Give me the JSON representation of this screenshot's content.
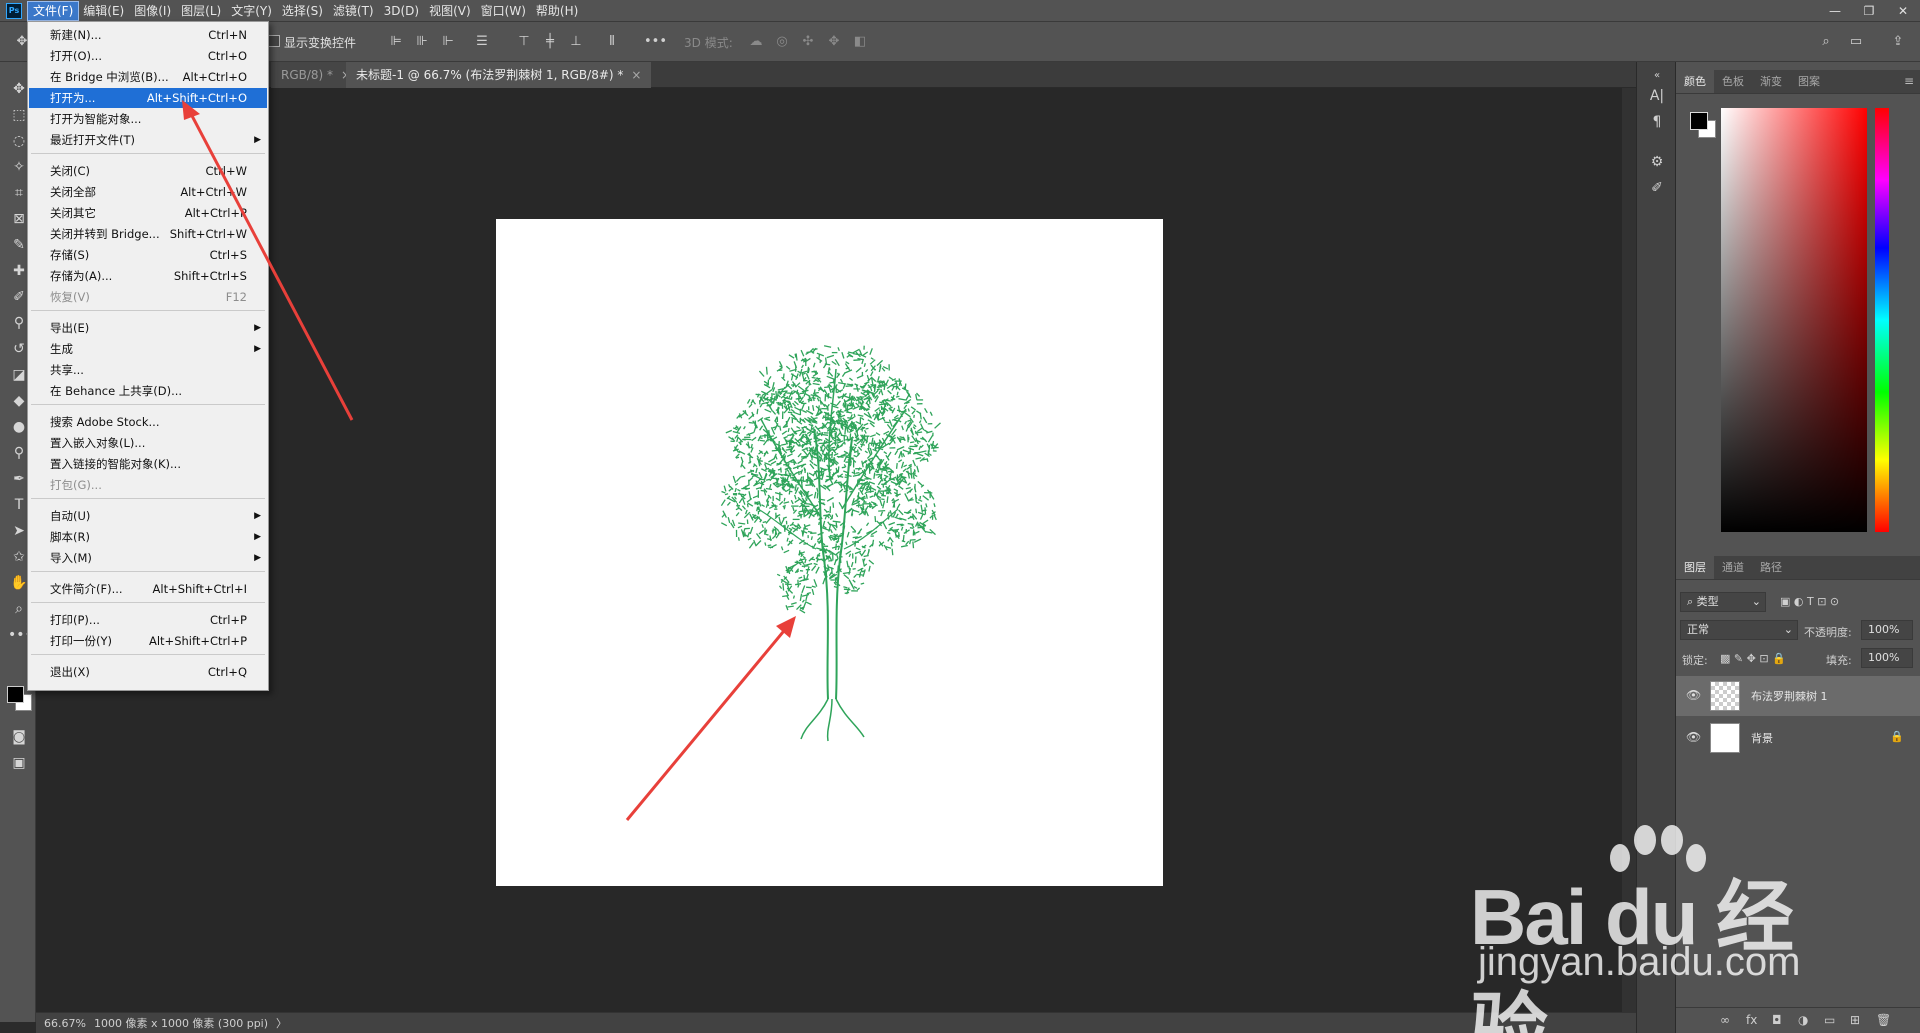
{
  "app": {
    "logo": "Ps",
    "menus": [
      "文件(F)",
      "编辑(E)",
      "图像(I)",
      "图层(L)",
      "文字(Y)",
      "选择(S)",
      "滤镜(T)",
      "3D(D)",
      "视图(V)",
      "窗口(W)",
      "帮助(H)"
    ],
    "window_controls": [
      "—",
      "❐",
      "✕"
    ]
  },
  "options_bar": {
    "show_transform_label": "显示变换控件",
    "mode_3d_label": "3D 模式:",
    "more_icon": "•••"
  },
  "tabs": [
    {
      "label": "RGB/8) *",
      "close": "×"
    },
    {
      "label": "未标题-1 @ 66.7% (布法罗荆棘树 1, RGB/8#) *",
      "close": "×"
    }
  ],
  "status_bar": {
    "zoom": "66.67%",
    "doc_info": "1000 像素 x 1000 像素 (300 ppi)",
    "arrow": "〉"
  },
  "file_menu": {
    "items": [
      {
        "label": "新建(N)...",
        "shortcut": "Ctrl+N"
      },
      {
        "label": "打开(O)...",
        "shortcut": "Ctrl+O"
      },
      {
        "label": "在 Bridge 中浏览(B)...",
        "shortcut": "Alt+Ctrl+O"
      },
      {
        "label": "打开为...",
        "shortcut": "Alt+Shift+Ctrl+O",
        "highlighted": true
      },
      {
        "label": "打开为智能对象...",
        "shortcut": ""
      },
      {
        "label": "最近打开文件(T)",
        "shortcut": "",
        "submenu": true
      },
      {
        "label": "关闭(C)",
        "shortcut": "Ctrl+W"
      },
      {
        "label": "关闭全部",
        "shortcut": "Alt+Ctrl+W"
      },
      {
        "label": "关闭其它",
        "shortcut": "Alt+Ctrl+P"
      },
      {
        "label": "关闭并转到 Bridge...",
        "shortcut": "Shift+Ctrl+W"
      },
      {
        "label": "存储(S)",
        "shortcut": "Ctrl+S"
      },
      {
        "label": "存储为(A)...",
        "shortcut": "Shift+Ctrl+S"
      },
      {
        "label": "恢复(V)",
        "shortcut": "F12",
        "disabled": true
      },
      {
        "label": "导出(E)",
        "shortcut": "",
        "submenu": true
      },
      {
        "label": "生成",
        "shortcut": "",
        "submenu": true
      },
      {
        "label": "共享...",
        "shortcut": ""
      },
      {
        "label": "在 Behance 上共享(D)...",
        "shortcut": ""
      },
      {
        "label": "搜索 Adobe Stock...",
        "shortcut": ""
      },
      {
        "label": "置入嵌入对象(L)...",
        "shortcut": ""
      },
      {
        "label": "置入链接的智能对象(K)...",
        "shortcut": ""
      },
      {
        "label": "打包(G)...",
        "shortcut": "",
        "disabled": true
      },
      {
        "label": "自动(U)",
        "shortcut": "",
        "submenu": true
      },
      {
        "label": "脚本(R)",
        "shortcut": "",
        "submenu": true
      },
      {
        "label": "导入(M)",
        "shortcut": "",
        "submenu": true
      },
      {
        "label": "文件简介(F)...",
        "shortcut": "Alt+Shift+Ctrl+I"
      },
      {
        "label": "打印(P)...",
        "shortcut": "Ctrl+P"
      },
      {
        "label": "打印一份(Y)",
        "shortcut": "Alt+Shift+Ctrl+P"
      },
      {
        "label": "退出(X)",
        "shortcut": "Ctrl+Q"
      }
    ],
    "submenu_arrow": "▶"
  },
  "color_panel": {
    "tabs": [
      "颜色",
      "色板",
      "渐变",
      "图案"
    ],
    "menu_icon": "≡",
    "foreground": "#000000",
    "background": "#ffffff",
    "hue_color": "#ff0000"
  },
  "layers_panel": {
    "tabs": [
      "图层",
      "通道",
      "路径"
    ],
    "filter_kind": "类型",
    "blend_mode": "正常",
    "opacity_label": "不透明度:",
    "opacity_value": "100%",
    "lock_label": "锁定:",
    "fill_label": "填充:",
    "fill_value": "100%",
    "layers": [
      {
        "name": "布法罗荆棘树 1",
        "selected": true,
        "locked": false
      },
      {
        "name": "背景",
        "selected": false,
        "locked": true
      }
    ],
    "footer_icons": [
      "link-icon",
      "fx-icon",
      "mask-icon",
      "adjustment-icon",
      "group-icon",
      "new-layer-icon",
      "trash-icon"
    ],
    "footer_labels": [
      "∞",
      "fx",
      "◘",
      "◑",
      "▭",
      "⊞",
      "🗑"
    ]
  },
  "watermark": {
    "main": "Bai du 经验",
    "sub": "jingyan.baidu.com"
  },
  "colors": {
    "accent": "#1f6fd6",
    "tree": "#2fa45a",
    "arrow": "#e8403a"
  }
}
